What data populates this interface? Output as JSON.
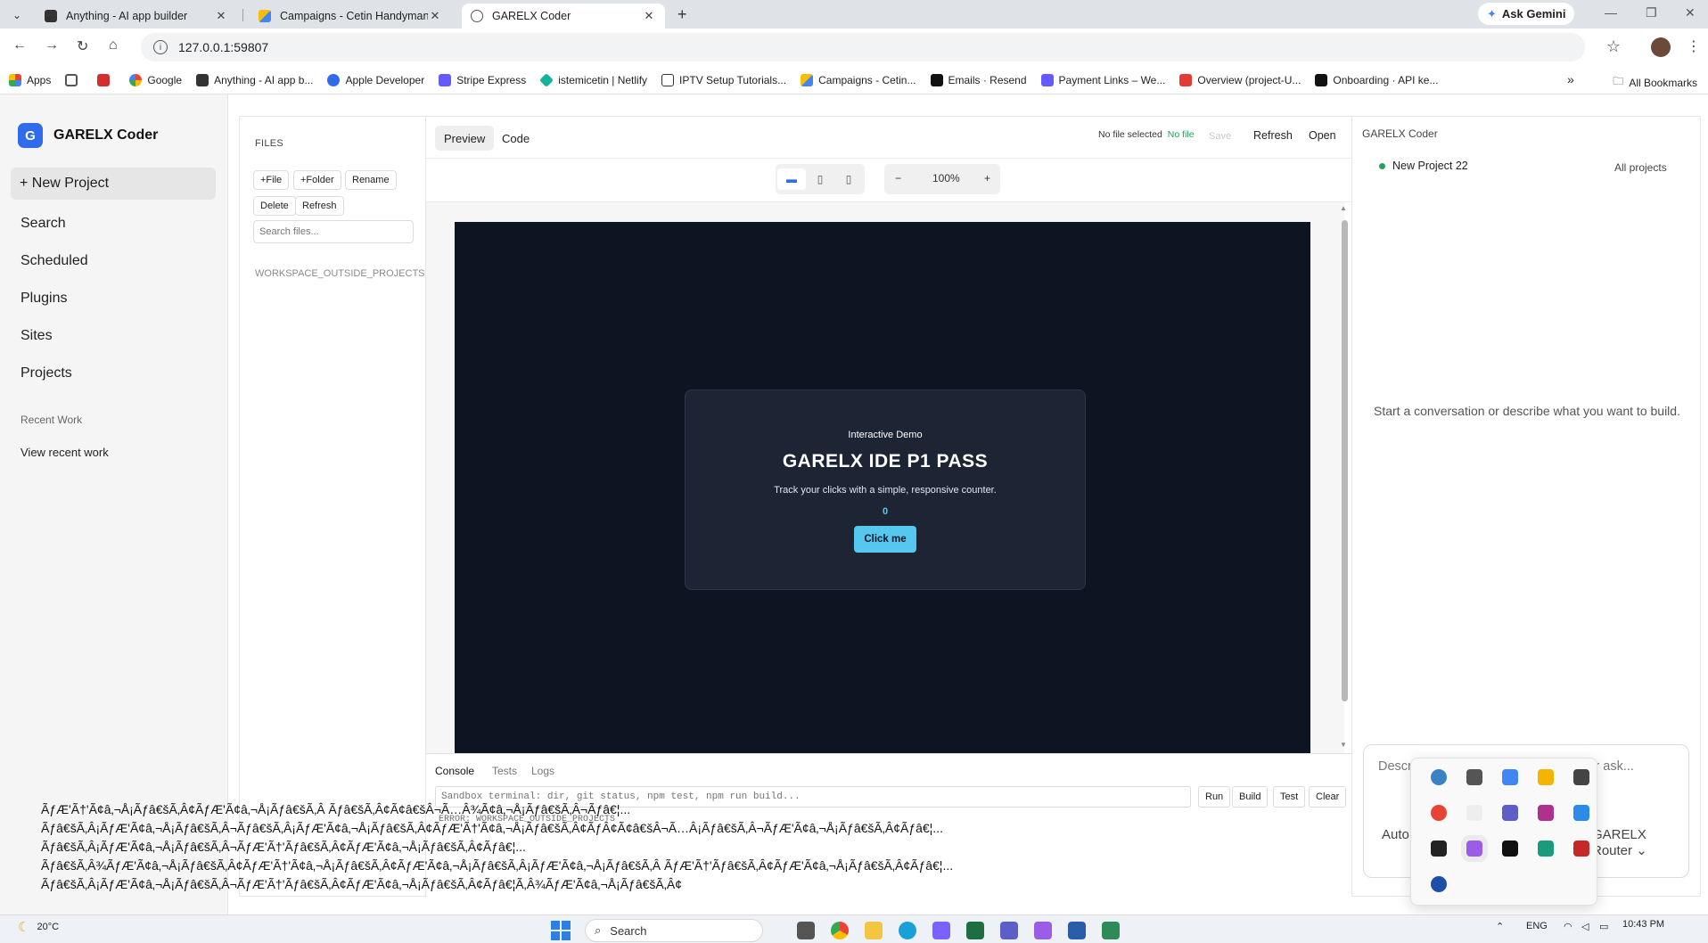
{
  "browser": {
    "tabs": [
      {
        "title": "Anything - AI app builder",
        "close": "✕"
      },
      {
        "title": "Campaigns - Cetin Handyman&...",
        "close": "✕"
      },
      {
        "title": "GARELX Coder",
        "close": "✕"
      }
    ],
    "new_tab": "+",
    "ask_gemini": "Ask Gemini",
    "url": "127.0.0.1:59807",
    "bookmarks": [
      "Apps",
      "Google",
      "Anything - AI app b...",
      "Apple Developer",
      "Stripe Express",
      "istemicetin | Netlify",
      "IPTV Setup Tutorials...",
      "Campaigns - Cetin...",
      "Emails · Resend",
      "Payment Links – We...",
      "Overview (project-U...",
      "Onboarding · API ke..."
    ],
    "all_bookmarks": "All Bookmarks"
  },
  "sidebar": {
    "brand_letter": "G",
    "brand_name": "GARELX Coder",
    "new_project": "+ New Project",
    "items": [
      "Search",
      "Scheduled",
      "Plugins",
      "Sites",
      "Projects"
    ],
    "recent_heading": "Recent Work",
    "recent_link": "View recent work"
  },
  "files": {
    "heading": "FILES",
    "buttons": [
      "+File",
      "+Folder",
      "Rename",
      "Delete",
      "Refresh"
    ],
    "search_placeholder": "Search files...",
    "workspace_label": "WORKSPACE_OUTSIDE_PROJECTS"
  },
  "editor": {
    "tabs": [
      "Preview",
      "Code"
    ],
    "no_file_selected": "No file selected",
    "no_file": "No file",
    "save": "Save",
    "refresh": "Refresh",
    "open": "Open",
    "zoom_minus": "−",
    "zoom_level": "100%",
    "zoom_plus": "+"
  },
  "preview": {
    "eyebrow": "Interactive Demo",
    "heading": "GARELX IDE P1 PASS",
    "subtitle": "Track your clicks with a simple, responsive counter.",
    "count": "0",
    "button": "Click me"
  },
  "console": {
    "tabs": [
      "Console",
      "Tests",
      "Logs"
    ],
    "placeholder": "Sandbox terminal: dir, git status, npm test, npm run build...",
    "buttons": [
      "Run",
      "Build",
      "Test",
      "Clear"
    ],
    "output": "ERROR: WORKSPACE_OUTSIDE_PROJECTS"
  },
  "chat": {
    "title": "GARELX Coder",
    "project": "New Project 22",
    "all_projects": "All projects",
    "empty": "Start a conversation or describe what you want to build.",
    "composer_placeholder": "Describe what you want to build, fix, or ask...",
    "auto": "Auto",
    "router": "GARELX Router"
  },
  "garbled_lines": [
    "ÃƒÆ'Ã†'Ã¢â‚¬Å¡Ãƒâ€šÃ‚Â¢ÃƒÆ'Ã¢â‚¬Å¡Ãƒâ€šÃ‚Â Ãƒâ€šÃ‚Â¢Ã¢â€šÂ¬Ã…Â¾Ã¢â‚¬Å¡Ãƒâ€šÃ‚Â¬Ãƒâ€¦...",
    "Ãƒâ€šÃ‚Â¡ÃƒÆ'Ã¢â‚¬Å¡Ãƒâ€šÃ‚Â¬Ãƒâ€šÃ‚Â¡ÃƒÆ'Ã¢â‚¬Å¡Ãƒâ€šÃ‚Â¢ÃƒÆ'Ã†'Ã¢â‚¬Å¡Ãƒâ€šÃ‚Â¢ÃƒÂ¢Ã¢â€šÂ¬Ã…Â¡Ãƒâ€šÃ‚Â¬ÃƒÆ'Ã¢â‚¬Å¡Ãƒâ€šÃ‚Â¢Ãƒâ€¦...",
    "Ãƒâ€šÃ‚Â¡ÃƒÆ'Ã¢â‚¬Å¡Ãƒâ€šÃ‚Â¬ÃƒÆ'Ã†'Ãƒâ€šÃ‚Â¢ÃƒÆ'Ã¢â‚¬Å¡Ãƒâ€šÃ‚Â¢Ãƒâ€¦...",
    "Ãƒâ€šÃ‚Â¾ÃƒÆ'Ã¢â‚¬Å¡Ãƒâ€šÃ‚Â¢ÃƒÆ'Ã†'Ã¢â‚¬Å¡Ãƒâ€šÃ‚Â¢ÃƒÆ'Ã¢â‚¬Å¡Ãƒâ€šÃ‚Â¡ÃƒÆ'Ã¢â‚¬Å¡Ãƒâ€šÃ‚Â ÃƒÆ'Ã†'Ãƒâ€šÃ‚Â¢ÃƒÆ'Ã¢â‚¬Å¡Ãƒâ€šÃ‚Â¢Ãƒâ€¦...",
    "Ãƒâ€šÃ‚Â¡ÃƒÆ'Ã¢â‚¬Å¡Ãƒâ€šÃ‚Â¬ÃƒÆ'Ã†'Ãƒâ€šÃ‚Â¢ÃƒÆ'Ã¢â‚¬Å¡Ãƒâ€šÃ‚Â¢Ãƒâ€¦Ã‚Â¾ÃƒÆ'Ã¢â‚¬Å¡Ãƒâ€šÃ‚Â¢"
  ],
  "taskbar": {
    "temperature": "20°C",
    "search": "Search",
    "lang": "ENG",
    "time": "10:43 PM"
  },
  "colors": {
    "accent": "#2f6bed",
    "preview_bg": "#0f1423",
    "card_bg": "#1d2535",
    "cyan": "#56c8ef",
    "status_green": "#1fa35b"
  }
}
